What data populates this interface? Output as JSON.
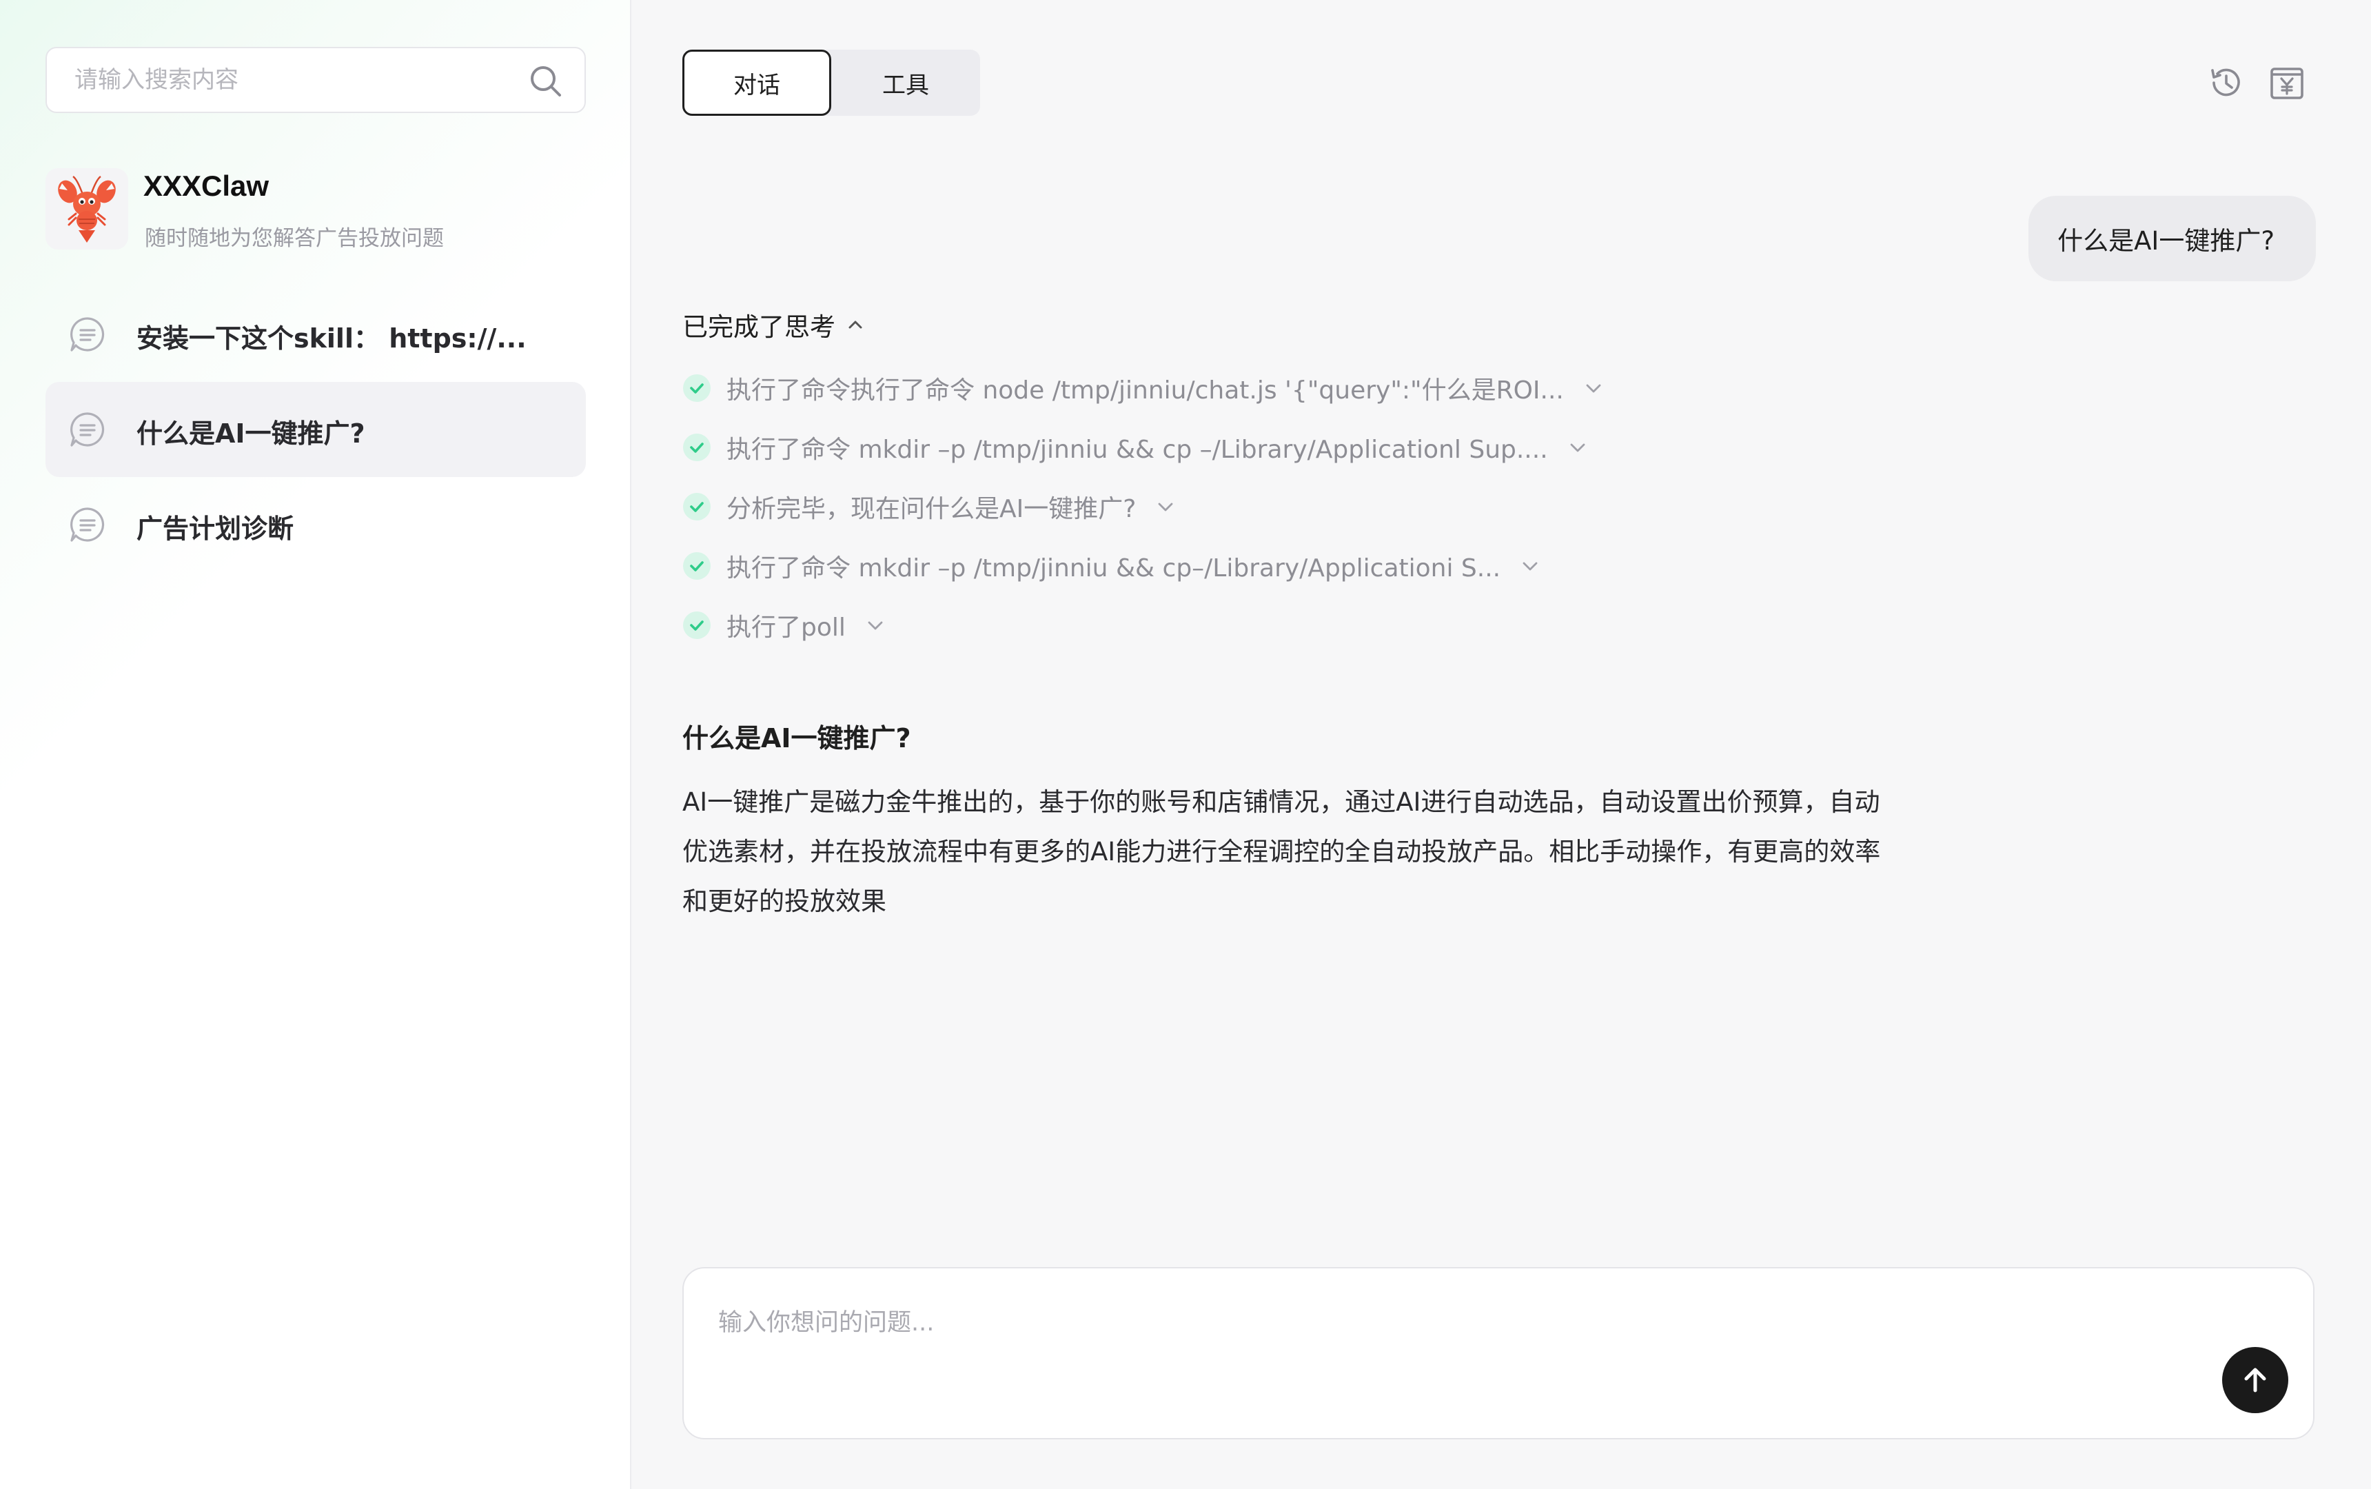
{
  "sidebar": {
    "search": {
      "placeholder": "请输入搜索内容",
      "value": ""
    },
    "agent": {
      "name": "XXXClaw",
      "description": "随时随地为您解答广告投放问题"
    },
    "history": [
      {
        "label": "安装一下这个skill： https://...",
        "active": false
      },
      {
        "label": "什么是AI一键推广?",
        "active": true
      },
      {
        "label": "广告计划诊断",
        "active": false
      }
    ]
  },
  "main": {
    "tabs": [
      {
        "label": "对话",
        "active": true
      },
      {
        "label": "工具",
        "active": false
      }
    ],
    "top_icons": [
      "history-icon",
      "yen-bill-icon"
    ],
    "user_message": "什么是AI一键推广?",
    "thinking": {
      "header": "已完成了思考",
      "steps": [
        {
          "text": "执行了命令执行了命令 node /tmp/jinniu/chat.js '{\"query\":\"什么是ROI..."
        },
        {
          "text": "执行了命令 mkdir –p /tmp/jinniu && cp –/Library/Applicationl Sup...."
        },
        {
          "text": "分析完毕，现在问什么是AI一键推广?"
        },
        {
          "text": "执行了命令 mkdir –p /tmp/jinniu && cp–/Library/Applicationi S..."
        },
        {
          "text": "执行了poll"
        }
      ]
    },
    "answer": {
      "title": "什么是AI一键推广?",
      "body": "AI一键推广是磁力金牛推出的，基于你的账号和店铺情况，通过AI进行自动选品，自动设置出价预算，自动优选素材，并在投放流程中有更多的AI能力进行全程调控的全自动投放产品。相比手动操作，有更高的效率和更好的投放效果"
    },
    "composer": {
      "placeholder": "输入你想问的问题...",
      "value": ""
    }
  },
  "colors": {
    "accent_green": "#2fcc8a",
    "check_bg": "#d8f5e8",
    "send_button": "#1a1a1a",
    "sidebar_gradient": "#eafaf1"
  }
}
